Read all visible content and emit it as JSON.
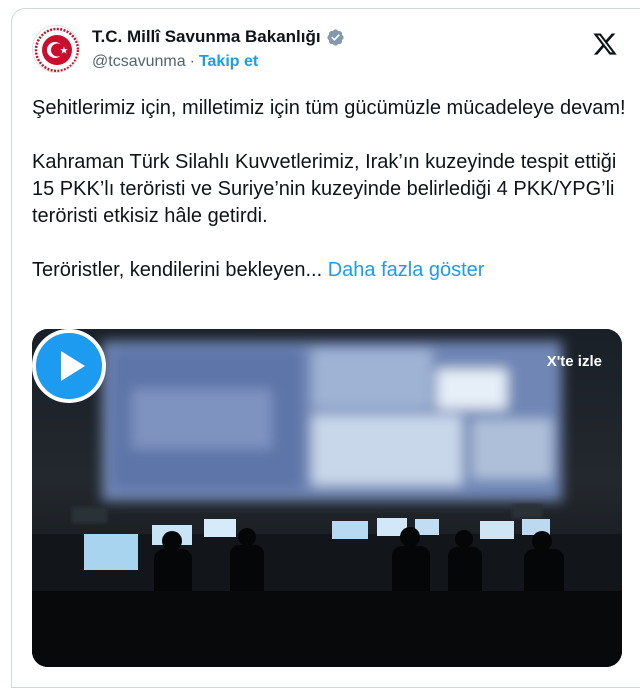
{
  "account": {
    "display_name": "T.C. Millî Savunma Bakanlığı",
    "handle": "@tcsavunma",
    "separator": "·",
    "follow_label": "Takip et",
    "verified": true,
    "avatar_icon": "ministry-emblem-icon"
  },
  "platform": {
    "logo_icon": "x-logo-icon"
  },
  "tweet": {
    "paragraphs": [
      "Şehitlerimiz için, milletimiz için tüm gücümüzle mücadeleye devam!",
      "Kahraman Türk Silahlı Kuvvetlerimiz, Irak’ın kuzeyinde tespit ettiği 15 PKK’lı teröristi ve Suriye’nin kuzeyinde belirlediği 4 PKK/YPG’li teröristi etkisiz hâle getirdi.",
      "Teröristler, kendilerini bekleyen..."
    ],
    "show_more_label": "Daha fazla göster"
  },
  "media": {
    "watch_label": "X'te izle",
    "play_icon": "play-icon"
  },
  "colors": {
    "accent": "#1d9bf0",
    "text": "#0f1419",
    "muted": "#536471",
    "border": "#cfd9de",
    "brand_red": "#c8102e"
  }
}
